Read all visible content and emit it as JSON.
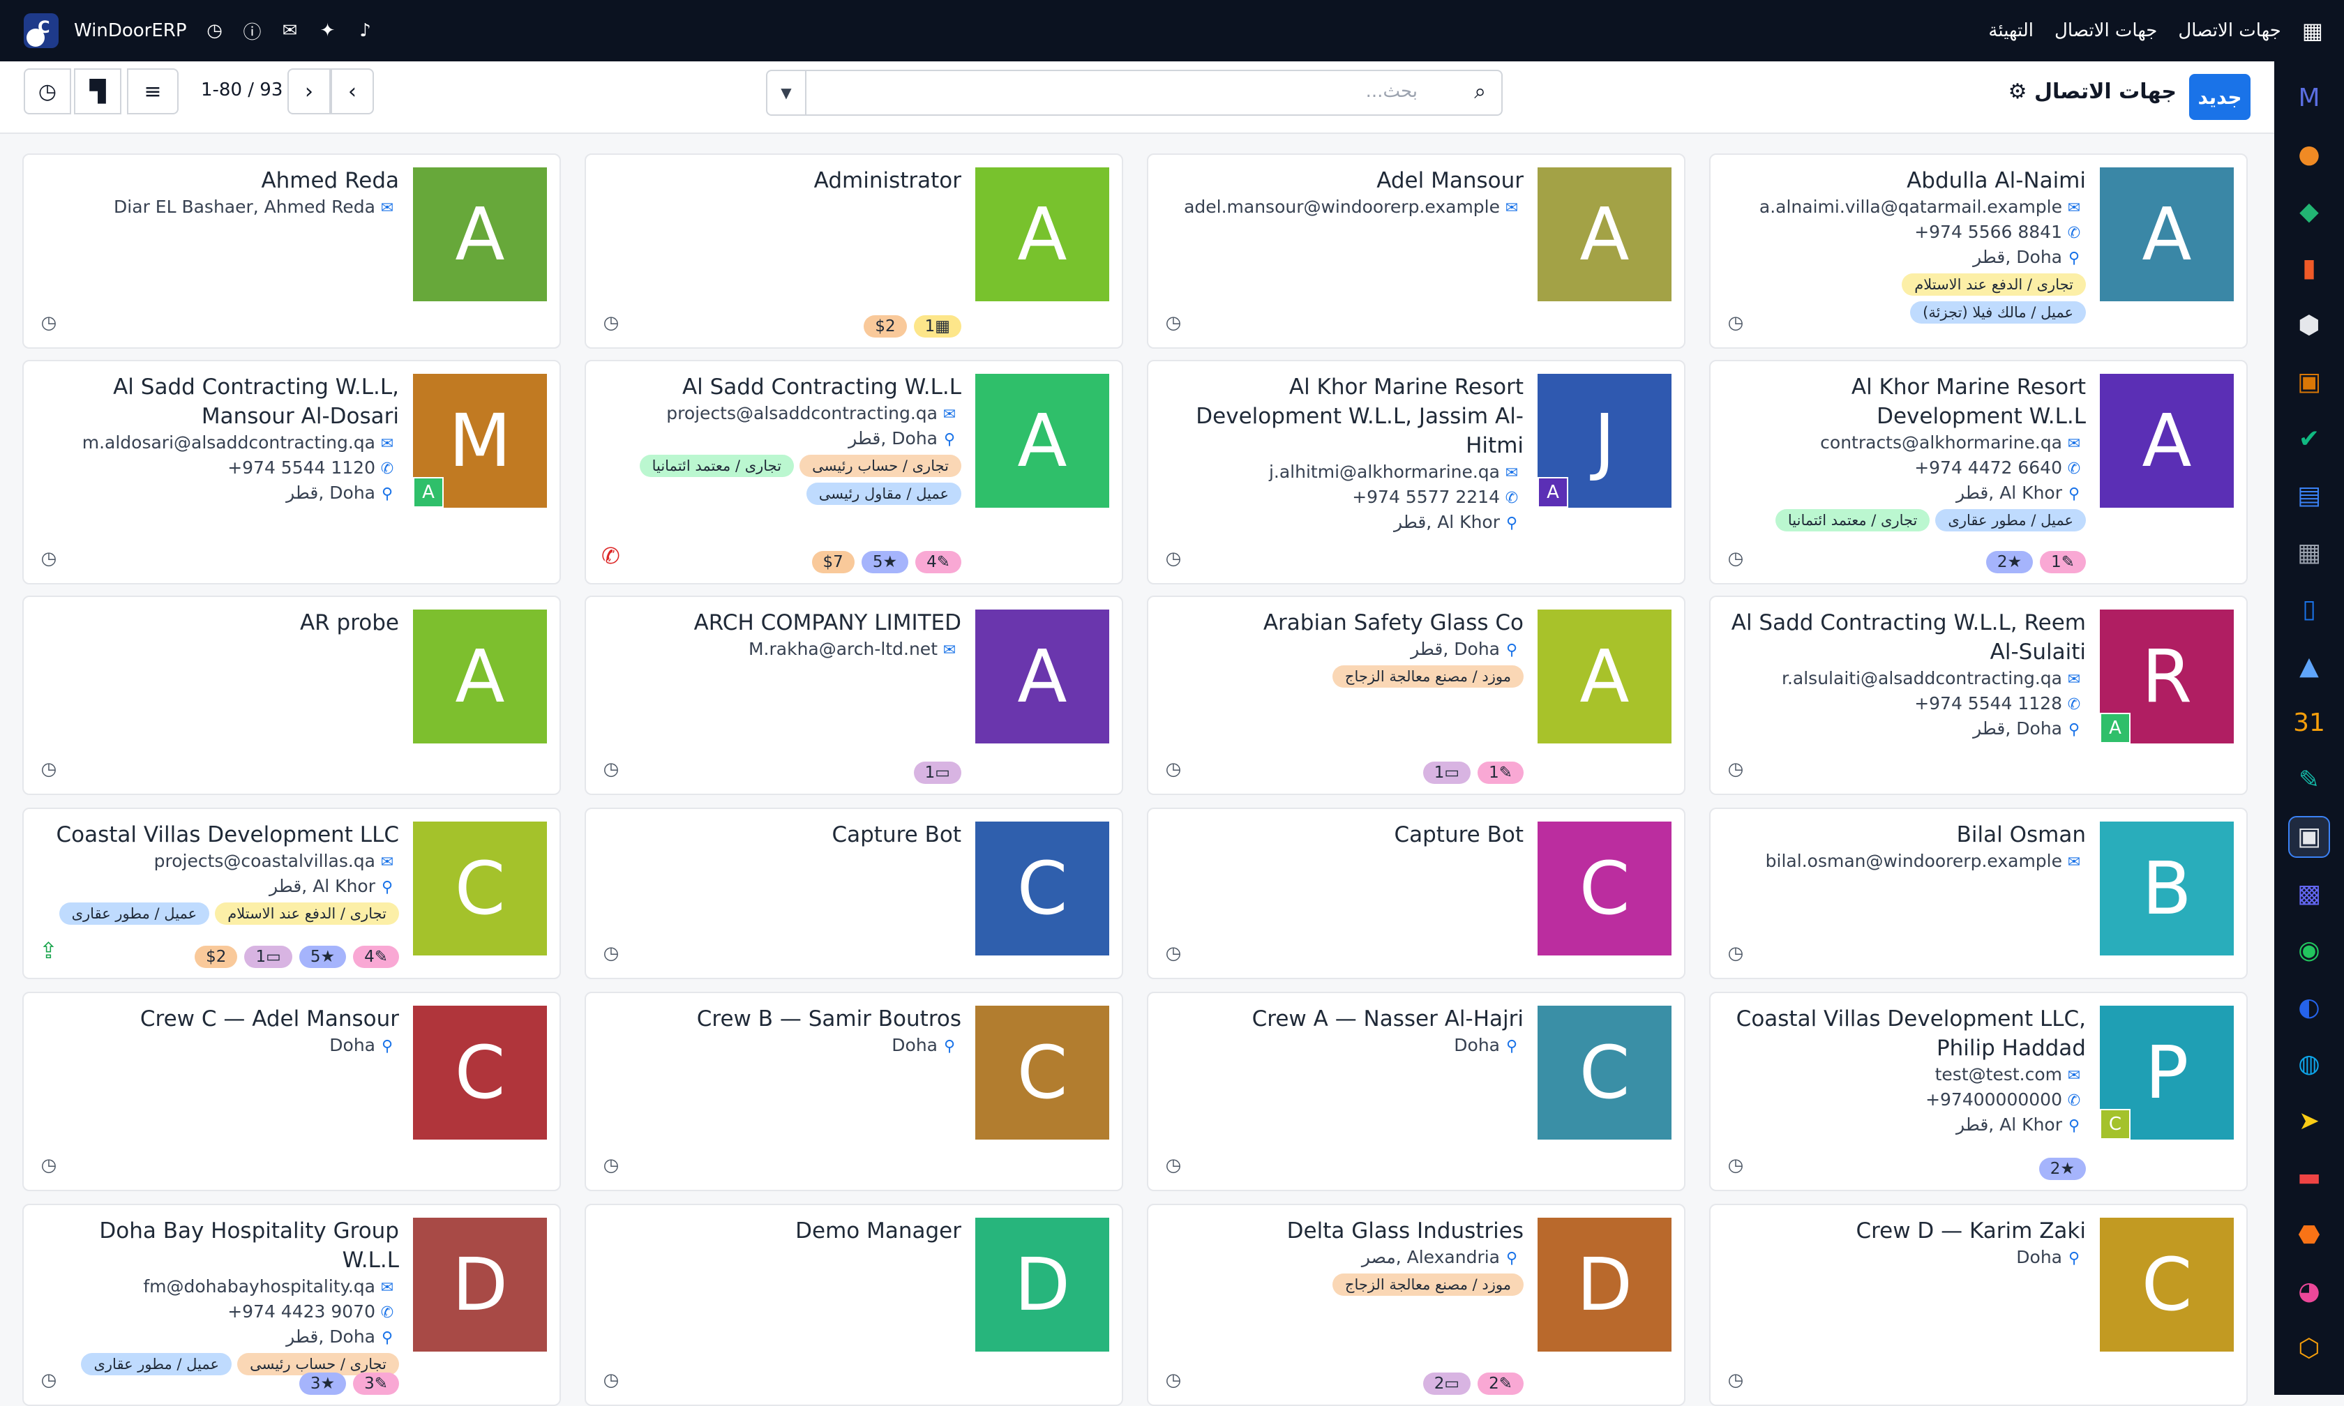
{
  "topbar": {
    "brand": "WinDoorERP",
    "icons": [
      "clock-icon",
      "help-icon",
      "chat-icon",
      "megaphone-icon",
      "bell-icon"
    ],
    "menu": [
      "جهات الاتصال",
      "جهات الاتصال",
      "التهيئة"
    ]
  },
  "control": {
    "new_label": "جديد",
    "title": "جهات الاتصال",
    "search_placeholder": "بحث...",
    "pager": "1-80 / 93"
  },
  "sidebar_apps": [
    "mail-app-icon",
    "chat-app-icon",
    "discuss-app-icon",
    "chart-app-icon",
    "inventory-app-icon",
    "photo-app-icon",
    "todo-app-icon",
    "kb-app-icon",
    "project-app-icon",
    "docs-app-icon",
    "team-app-icon",
    "calendar-app-icon",
    "sign-app-icon",
    "contacts-app-icon",
    "dashboard-app-icon",
    "whatsapp-app-icon",
    "planning-app-icon",
    "helpdesk-app-icon",
    "send-app-icon",
    "tasks-app-icon",
    "studio-app-icon",
    "pie-app-icon",
    "settings-app-icon"
  ],
  "colors": {
    "accent": "#1a73e8",
    "topbar": "#0b1220"
  },
  "cards": [
    {
      "name": "Abdulla Al-Naimi",
      "letter": "A",
      "color": "#3a87a6",
      "email": "a.alnaimi.villa@qatarmail.example",
      "phone": "+974 5566 8841",
      "location": "Doha ,قطر",
      "tags": [
        {
          "t": "تجارى / الدفع عند الاستلام",
          "c": "yellow"
        },
        {
          "t": "عميل / مالك فيلا (تجزئة)",
          "c": "blue"
        }
      ],
      "badges": []
    },
    {
      "name": "Adel Mansour",
      "letter": "A",
      "color": "#a3a246",
      "email": "adel.mansour@windoorerp.example",
      "tags": [],
      "badges": []
    },
    {
      "name": "Administrator",
      "letter": "A",
      "color": "#78c22d",
      "tags": [],
      "badges": [
        {
          "t": "1",
          "ic": "calendar",
          "c": "b-yellow"
        },
        {
          "t": "$2",
          "c": "b-peach"
        }
      ]
    },
    {
      "name": "Ahmed Reda",
      "letter": "A",
      "color": "#67a83a",
      "email": "Diar EL Bashaer, Ahmed Reda",
      "tags": [],
      "badges": []
    },
    {
      "name": "Al Khor Marine Resort Development W.L.L",
      "letter": "A",
      "color": "#5b2fb5",
      "email": "contracts@alkhormarine.qa",
      "phone": "+974 4472 6640",
      "location": "Al Khor ,قطر",
      "tags": [
        {
          "t": "عميل / مطور عقارى",
          "c": "blue"
        },
        {
          "t": "تجارى / معتمد ائتمانيا",
          "c": "green"
        }
      ],
      "badges": [
        {
          "t": "1",
          "ic": "edit",
          "c": "b-pink"
        },
        {
          "t": "2",
          "ic": "star",
          "c": "b-blue"
        }
      ]
    },
    {
      "name": "Al Khor Marine Resort Development W.L.L, Jassim Al-Hitmi",
      "letter": "J",
      "color": "#2f59b0",
      "sub": "A",
      "subColor": "#5b2fb5",
      "email": "j.alhitmi@alkhormarine.qa",
      "phone": "+974 5577 2214",
      "location": "Al Khor ,قطر",
      "tags": [],
      "badges": []
    },
    {
      "name": "Al Sadd Contracting W.L.L",
      "letter": "A",
      "color": "#2fbf6a",
      "email": "projects@alsaddcontracting.qa",
      "location": "Doha ,قطر",
      "tags": [
        {
          "t": "تجارى / حساب رئيسى",
          "c": "peach"
        },
        {
          "t": "تجارى / معتمد ائتمانيا",
          "c": "green"
        },
        {
          "t": "عميل / مقاول رئيسى",
          "c": "blue"
        }
      ],
      "badges": [
        {
          "t": "4",
          "ic": "edit",
          "c": "b-pink"
        },
        {
          "t": "5",
          "ic": "star",
          "c": "b-blue"
        },
        {
          "t": "$7",
          "c": "b-peach"
        }
      ],
      "action": "phone"
    },
    {
      "name": "Al Sadd Contracting W.L.L, Mansour Al-Dosari",
      "letter": "M",
      "color": "#c17a22",
      "sub": "A",
      "subColor": "#2fbf6a",
      "email": "m.aldosari@alsaddcontracting.qa",
      "phone": "+974 5544 1120",
      "location": "Doha ,قطر",
      "tags": [],
      "badges": []
    },
    {
      "name": "Al Sadd Contracting W.L.L, Reem Al-Sulaiti",
      "letter": "R",
      "color": "#b01e62",
      "sub": "A",
      "subColor": "#2fbf6a",
      "email": "r.alsulaiti@alsaddcontracting.qa",
      "phone": "+974 5544 1128",
      "location": "Doha ,قطر",
      "tags": [],
      "badges": []
    },
    {
      "name": "Arabian Safety Glass Co",
      "letter": "A",
      "color": "#a8c22a",
      "location": "Doha ,قطر",
      "tags": [
        {
          "t": "موزد / مصنع معالجة الزجاج",
          "c": "peach"
        }
      ],
      "badges": [
        {
          "t": "1",
          "ic": "edit",
          "c": "b-pink"
        },
        {
          "t": "1",
          "ic": "card",
          "c": "b-purple"
        }
      ]
    },
    {
      "name": "ARCH COMPANY LIMITED",
      "letter": "A",
      "color": "#6a36ad",
      "email": "M.rakha@arch-ltd.net",
      "tags": [],
      "badges": [
        {
          "t": "1",
          "ic": "card",
          "c": "b-purple"
        }
      ]
    },
    {
      "name": "AR probe",
      "letter": "A",
      "color": "#7dbf2e",
      "tags": [],
      "badges": []
    },
    {
      "name": "Bilal Osman",
      "letter": "B",
      "color": "#29adbb",
      "email": "bilal.osman@windoorerp.example",
      "tags": [],
      "badges": []
    },
    {
      "name": "Capture Bot",
      "letter": "C",
      "color": "#bb2d9f",
      "tags": [],
      "badges": []
    },
    {
      "name": "Capture Bot",
      "letter": "C",
      "color": "#2f5fad",
      "tags": [],
      "badges": []
    },
    {
      "name": "Coastal Villas Development LLC",
      "letter": "C",
      "color": "#a4c22b",
      "email": "projects@coastalvillas.qa",
      "location": "Al Khor ,قطر",
      "tags": [
        {
          "t": "تجارى / الدفع عند الاستلام",
          "c": "yellow"
        },
        {
          "t": "عميل / مطور عقارى",
          "c": "blue"
        }
      ],
      "badges": [
        {
          "t": "4",
          "ic": "edit",
          "c": "b-pink"
        },
        {
          "t": "5",
          "ic": "star",
          "c": "b-blue"
        },
        {
          "t": "1",
          "ic": "card",
          "c": "b-purple"
        },
        {
          "t": "$2",
          "c": "b-peach"
        }
      ],
      "action": "upload"
    },
    {
      "name": "Coastal Villas Development LLC, Philip Haddad",
      "letter": "P",
      "color": "#1f9fb4",
      "sub": "C",
      "subColor": "#a4c22b",
      "email": "test@test.com",
      "phone": "+97400000000",
      "location": "Al Khor ,قطر",
      "tags": [],
      "badges": [
        {
          "t": "2",
          "ic": "star",
          "c": "b-blue"
        }
      ]
    },
    {
      "name": "Crew A — Nasser Al-Hajri",
      "letter": "C",
      "color": "#3a8fa6",
      "location": "Doha",
      "tags": [],
      "badges": []
    },
    {
      "name": "Crew B — Samir Boutros",
      "letter": "C",
      "color": "#b27d2f",
      "location": "Doha",
      "tags": [],
      "badges": []
    },
    {
      "name": "Crew C — Adel Mansour",
      "letter": "C",
      "color": "#b0353b",
      "location": "Doha",
      "tags": [],
      "badges": []
    },
    {
      "name": "Crew D — Karim Zaki",
      "letter": "C",
      "color": "#c29a22",
      "location": "Doha",
      "tags": [],
      "badges": []
    },
    {
      "name": "Delta Glass Industries",
      "letter": "D",
      "color": "#b9692c",
      "location": "Alexandria ,مصر",
      "tags": [
        {
          "t": "موزد / مصنع معالجة الزجاج",
          "c": "peach"
        }
      ],
      "badges": [
        {
          "t": "2",
          "ic": "edit",
          "c": "b-pink"
        },
        {
          "t": "2",
          "ic": "card",
          "c": "b-purple"
        }
      ]
    },
    {
      "name": "Demo Manager",
      "letter": "D",
      "color": "#27b57c",
      "tags": [],
      "badges": []
    },
    {
      "name": "Doha Bay Hospitality Group W.L.L",
      "letter": "D",
      "color": "#a84a46",
      "email": "fm@dohabayhospitality.qa",
      "phone": "+974 4423 9070",
      "location": "Doha ,قطر",
      "tags": [
        {
          "t": "تجارى / حساب رئيسى",
          "c": "peach"
        },
        {
          "t": "عميل / مطور عقارى",
          "c": "blue"
        }
      ],
      "badges": [
        {
          "t": "3",
          "ic": "edit",
          "c": "b-pink"
        },
        {
          "t": "3",
          "ic": "star",
          "c": "b-blue"
        }
      ]
    }
  ]
}
